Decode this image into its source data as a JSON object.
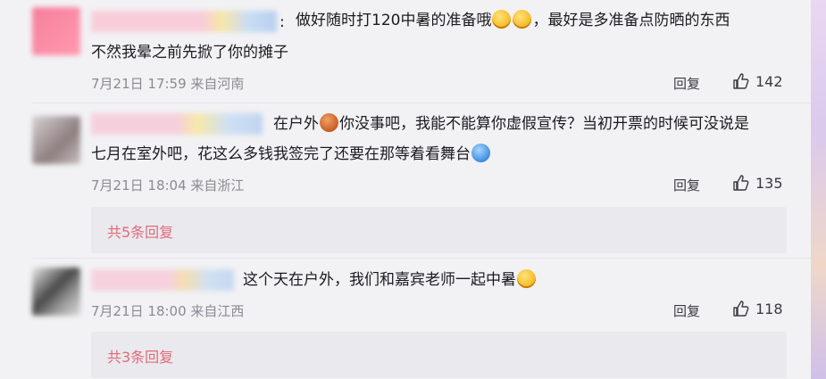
{
  "comments": [
    {
      "text_lines": [
        "做好随时打120中暑的准备哦",
        "，最好是多准备点防晒的东西",
        "不然我晕之前先掀了你的摊子"
      ],
      "meta": "7月21日 17:59 来自河南",
      "reply_label": "回复",
      "likes": "142",
      "emoji": [
        "yellow-face-emoji",
        "yellow-face-emoji"
      ]
    },
    {
      "text_lines": [
        "在户外",
        "你没事吧，我能不能算你虚假宣传？当初开票的时候可没说是",
        "七月在室外吧，花这么多钱我签完了还要在那等着看舞台"
      ],
      "meta": "7月21日 18:04 来自浙江",
      "reply_label": "回复",
      "likes": "135",
      "more_replies": "共5条回复",
      "emoji": [
        "brown-face-emoji",
        "blue-face-emoji"
      ]
    },
    {
      "text_lines": [
        "这个天在户外，我们和嘉宾老师一起中暑"
      ],
      "meta": "7月21日 18:00 来自江西",
      "reply_label": "回复",
      "likes": "118",
      "more_replies": "共3条回复",
      "emoji": [
        "yellow-face-emoji"
      ]
    }
  ],
  "colors": {
    "background": "#f2f2f5",
    "more_link": "#e16b78",
    "meta_text": "#8a8a92"
  }
}
